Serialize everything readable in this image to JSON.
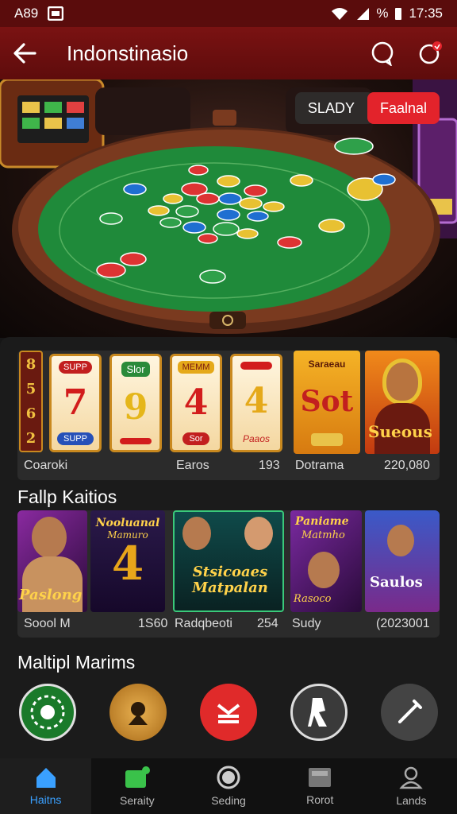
{
  "status_bar": {
    "left": "A89",
    "battery": "%",
    "time": "17:35"
  },
  "app_bar": {
    "title": "Indonstinasio"
  },
  "hero": {
    "tabs": [
      {
        "label": "SLADY"
      },
      {
        "label": "Faalnal"
      }
    ]
  },
  "row1": {
    "reels": [
      {
        "top": "SUPP",
        "num": "7",
        "bottom": "SUPP"
      },
      {
        "top": "Slor",
        "num": "9",
        "bottom": ""
      },
      {
        "top": "MEMM",
        "num": "4",
        "bottom": "Sor"
      },
      {
        "top": "",
        "num": "4",
        "bottom": "Paaos"
      }
    ],
    "side_numbers": [
      "8",
      "5",
      "6",
      "2"
    ],
    "sot_top": "Saraeau",
    "sot_text": "Sot",
    "sueus_text": "Sueous",
    "captions": {
      "c1": "Coaroki",
      "c2": "Earos",
      "c3": "193",
      "c4": "Dotrama",
      "c5": "220,080"
    }
  },
  "section1": {
    "title": "Fallp Kaitios"
  },
  "row2": {
    "tile_texts": {
      "t1": "Paslong",
      "t2a": "Nooluanal",
      "t2b": "Mamuro",
      "t3": "Stsicoaes Matpalan",
      "t4a": "Paniame",
      "t4b": "Matmho",
      "t4c": "Rasoco",
      "t5": "Saulos"
    },
    "captions": {
      "c1": "Soool M",
      "c2": "1S60",
      "c3": "Radqbeoti",
      "c4": "254",
      "c5": "Sudy",
      "c6": "(2023001"
    }
  },
  "section2": {
    "title": "Maltipl Marims"
  },
  "nav": [
    {
      "label": "Haitns"
    },
    {
      "label": "Seraity"
    },
    {
      "label": "Seding"
    },
    {
      "label": "Rorot"
    },
    {
      "label": "Lands"
    }
  ],
  "colors": {
    "accent_red": "#e3232b",
    "app_bar": "#6a0e0e",
    "nav_active": "#3aa0ff",
    "felt": "#1f8a3a"
  }
}
